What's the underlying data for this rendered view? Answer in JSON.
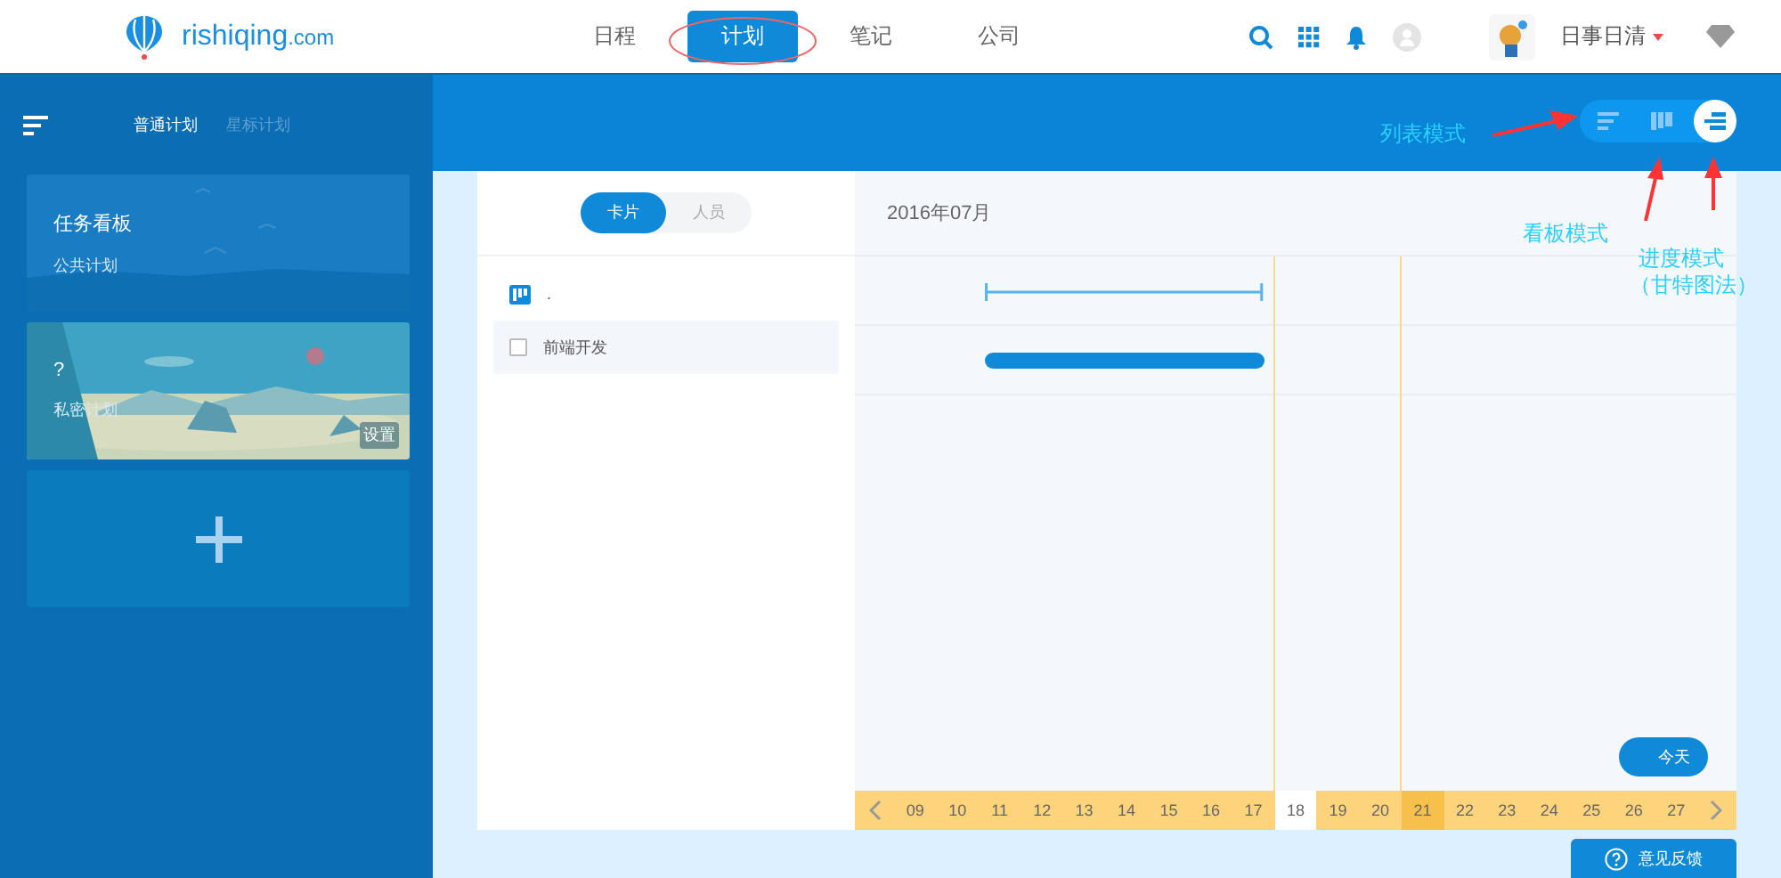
{
  "header": {
    "logo": "rishiqing",
    "logo_suffix": ".com",
    "nav": [
      {
        "label": "日程",
        "selected": false
      },
      {
        "label": "计划",
        "selected": true
      },
      {
        "label": "笔记",
        "selected": false
      },
      {
        "label": "公司",
        "selected": false
      }
    ],
    "user": "日事日清"
  },
  "sidebar": {
    "tabs": [
      {
        "label": "普通计划",
        "selected": true
      },
      {
        "label": "星标计划",
        "selected": false
      }
    ],
    "cards": [
      {
        "kind": "plain",
        "title": "任务看板",
        "subtitle": "公共计划"
      },
      {
        "kind": "picture",
        "title": "?",
        "subtitle": "私密计划",
        "action": "设置"
      },
      {
        "kind": "add"
      }
    ]
  },
  "view_modes": [
    {
      "kind": "list",
      "selected": false
    },
    {
      "kind": "board",
      "selected": false
    },
    {
      "kind": "gantt",
      "selected": true
    }
  ],
  "panel": {
    "tabs": [
      {
        "label": "卡片",
        "selected": true
      },
      {
        "label": "人员",
        "selected": false
      }
    ],
    "month": "2016年07月",
    "items": [
      {
        "kind": "board",
        "label": "."
      },
      {
        "kind": "task",
        "label": "前端开发",
        "checked": false
      }
    ],
    "days": [
      {
        "label": "09",
        "selected": false,
        "today": false
      },
      {
        "label": "10",
        "selected": false,
        "today": false
      },
      {
        "label": "11",
        "selected": false,
        "today": false
      },
      {
        "label": "12",
        "selected": false,
        "today": false
      },
      {
        "label": "13",
        "selected": false,
        "today": false
      },
      {
        "label": "14",
        "selected": false,
        "today": false
      },
      {
        "label": "15",
        "selected": false,
        "today": false
      },
      {
        "label": "16",
        "selected": false,
        "today": false
      },
      {
        "label": "17",
        "selected": false,
        "today": false
      },
      {
        "label": "18",
        "selected": true,
        "today": false
      },
      {
        "label": "19",
        "selected": false,
        "today": false
      },
      {
        "label": "20",
        "selected": false,
        "today": false
      },
      {
        "label": "21",
        "selected": false,
        "today": true
      },
      {
        "label": "22",
        "selected": false,
        "today": false
      },
      {
        "label": "23",
        "selected": false,
        "today": false
      },
      {
        "label": "24",
        "selected": false,
        "today": false
      },
      {
        "label": "25",
        "selected": false,
        "today": false
      },
      {
        "label": "26",
        "selected": false,
        "today": false
      },
      {
        "label": "27",
        "selected": false,
        "today": false
      }
    ],
    "today_button": "今天"
  },
  "feedback": "意见反馈",
  "annotations": [
    {
      "text": "列表模式"
    },
    {
      "text": "看板模式"
    },
    {
      "text": "进度模式"
    },
    {
      "text": "（甘特图法）"
    }
  ]
}
